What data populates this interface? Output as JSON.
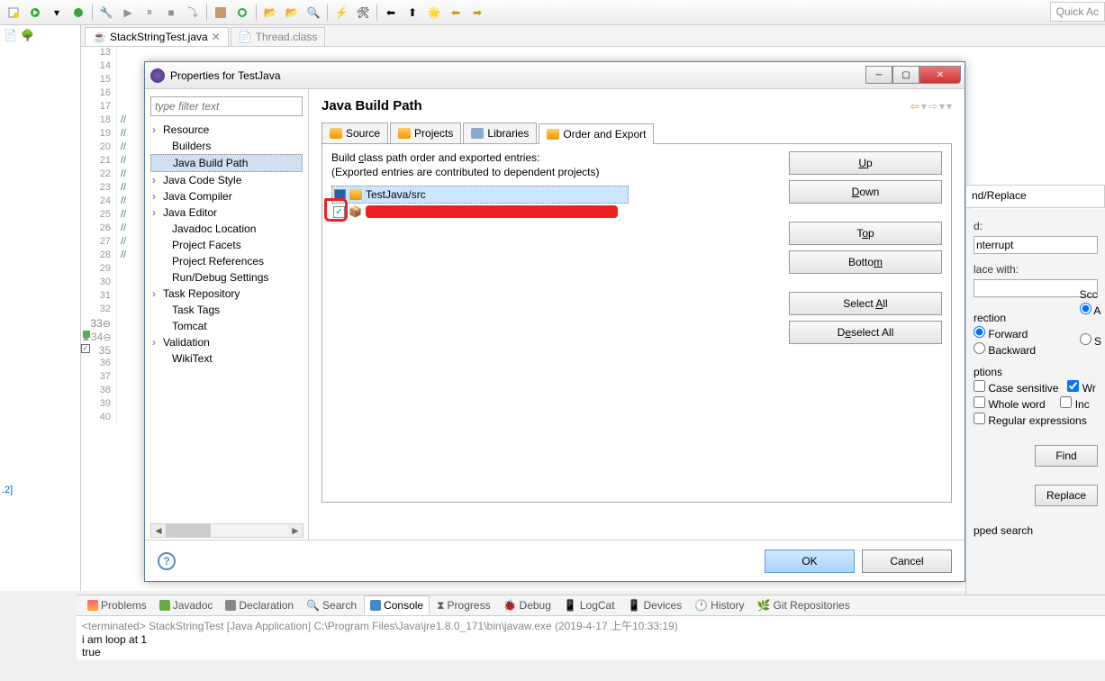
{
  "toolbar": {
    "quick_access": "Quick Ac"
  },
  "editor": {
    "tab1": "StackStringTest.java",
    "tab2": "Thread.class",
    "lines": [
      "13",
      "14",
      "15",
      "16",
      "17",
      "18",
      "19",
      "20",
      "21",
      "22",
      "23",
      "24",
      "25",
      "26",
      "27",
      "28",
      "29",
      "30",
      "31",
      "32",
      "33",
      "34",
      "35",
      "36",
      "37",
      "38",
      "39",
      "40"
    ],
    "comments": [
      "//",
      "//",
      "//",
      "//",
      "//",
      "//",
      "//",
      "//",
      "//",
      "//",
      "//",
      "//"
    ]
  },
  "left_label": ".2]",
  "dialog": {
    "title": "Properties for TestJava",
    "filter_placeholder": "type filter text",
    "nav": {
      "resource": "Resource",
      "builders": "Builders",
      "java_build_path": "Java Build Path",
      "java_code_style": "Java Code Style",
      "java_compiler": "Java Compiler",
      "java_editor": "Java Editor",
      "javadoc_location": "Javadoc Location",
      "project_facets": "Project Facets",
      "project_references": "Project References",
      "run_debug": "Run/Debug Settings",
      "task_repository": "Task Repository",
      "task_tags": "Task Tags",
      "tomcat": "Tomcat",
      "validation": "Validation",
      "wikitext": "WikiText"
    },
    "page_title": "Java Build Path",
    "tabs": {
      "source": "Source",
      "projects": "Projects",
      "libraries": "Libraries",
      "order_export": "Order and Export"
    },
    "desc1": "Build class path order and exported entries:",
    "desc2": "(Exported entries are contributed to dependent projects)",
    "entry1": "TestJava/src",
    "buttons": {
      "up": "Up",
      "down": "Down",
      "top": "Top",
      "bottom": "Bottom",
      "select_all": "Select All",
      "deselect_all": "Deselect All"
    },
    "ok": "OK",
    "cancel": "Cancel"
  },
  "find_replace": {
    "title": "nd/Replace",
    "find_lbl": "d:",
    "find_val": "nterrupt",
    "replace_lbl": "lace with:",
    "direction": "rection",
    "forward": "Forward",
    "backward": "Backward",
    "scope": "Scc",
    "scope_a": "A",
    "scope_s": "S",
    "options": "ptions",
    "case_sensitive": "Case sensitive",
    "wrap": "Wr",
    "whole_word": "Whole word",
    "inc": "Inc",
    "regex": "Regular expressions",
    "find_btn": "Find",
    "replace_btn": "Replace",
    "wrapped": "pped search"
  },
  "bottom": {
    "problems": "Problems",
    "javadoc": "Javadoc",
    "declaration": "Declaration",
    "search": "Search",
    "console": "Console",
    "progress": "Progress",
    "debug": "Debug",
    "logcat": "LogCat",
    "devices": "Devices",
    "history": "History",
    "git": "Git Repositories"
  },
  "console": {
    "header": "<terminated> StackStringTest [Java Application] C:\\Program Files\\Java\\jre1.8.0_171\\bin\\javaw.exe (2019-4-17 上午10:33:19)",
    "l1": "i am loop at 1",
    "l2": "true"
  }
}
